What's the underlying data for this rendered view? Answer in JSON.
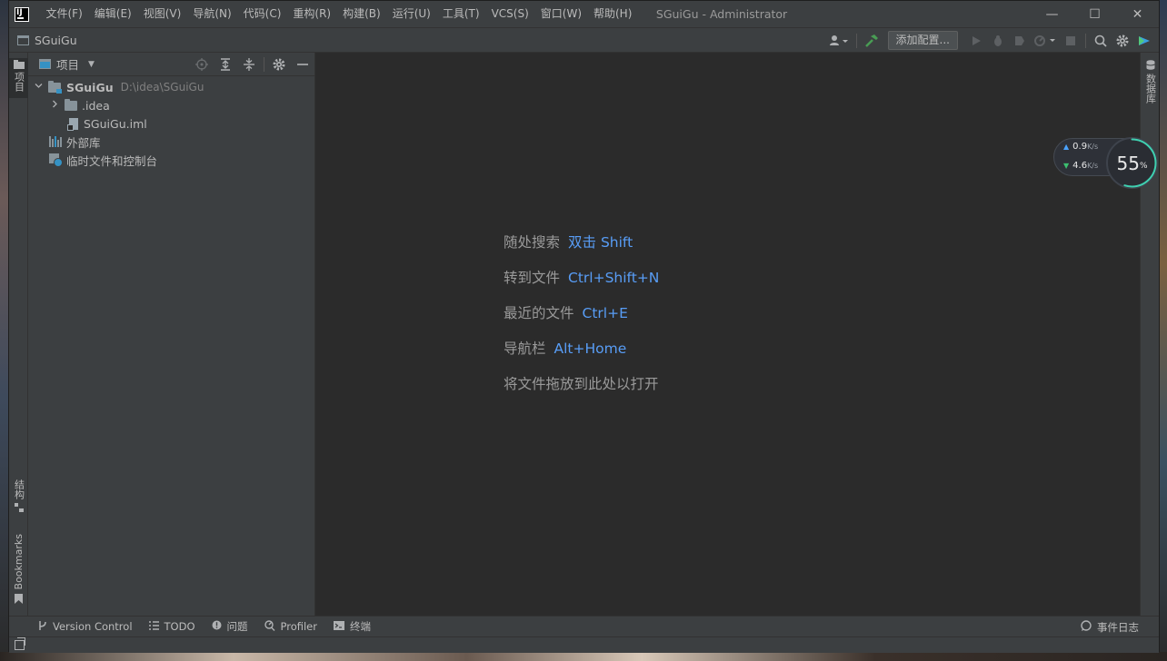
{
  "app": {
    "logo_text": "IJ",
    "window_title": "SGuiGu - Administrator"
  },
  "menu": [
    {
      "label": "文件(F)"
    },
    {
      "label": "编辑(E)"
    },
    {
      "label": "视图(V)"
    },
    {
      "label": "导航(N)"
    },
    {
      "label": "代码(C)"
    },
    {
      "label": "重构(R)"
    },
    {
      "label": "构建(B)"
    },
    {
      "label": "运行(U)"
    },
    {
      "label": "工具(T)"
    },
    {
      "label": "VCS(S)"
    },
    {
      "label": "窗口(W)"
    },
    {
      "label": "帮助(H)"
    }
  ],
  "window_controls": {
    "minimize": "—",
    "maximize": "☐",
    "close": "✕"
  },
  "navbar": {
    "project_name": "SGuiGu",
    "add_config_label": "添加配置...",
    "icons": [
      "user-icon",
      "build-hammer-icon",
      "run-icon",
      "debug-icon",
      "coverage-icon",
      "profile-icon",
      "stop-icon",
      "search-icon",
      "settings-icon",
      "toolbox-icon"
    ]
  },
  "left_stripe": {
    "project_tab": "项目",
    "structure_tab": "结构",
    "bookmarks_tab": "Bookmarks"
  },
  "right_stripe": {
    "database_tab": "数据库"
  },
  "project_panel": {
    "title": "项目",
    "tree": [
      {
        "label": "SGuiGu",
        "hint": "D:\\idea\\SGuiGu"
      },
      {
        "label": ".idea"
      },
      {
        "label": "SGuiGu.iml"
      },
      {
        "label": "外部库"
      },
      {
        "label": "临时文件和控制台"
      }
    ]
  },
  "editor_hints": [
    {
      "label": "随处搜索",
      "key": "双击 Shift"
    },
    {
      "label": "转到文件",
      "key": "Ctrl+Shift+N"
    },
    {
      "label": "最近的文件",
      "key": "Ctrl+E"
    },
    {
      "label": "导航栏",
      "key": "Alt+Home"
    },
    {
      "label": "将文件拖放到此处以打开",
      "key": ""
    }
  ],
  "net_widget": {
    "upload": "0.9",
    "download": "4.6",
    "unit": "K/s",
    "percent": "55",
    "percent_sign": "%",
    "percent_value": 55
  },
  "bottom_tools": [
    {
      "label": "Version Control",
      "icon": "branch-icon"
    },
    {
      "label": "TODO",
      "icon": "list-icon"
    },
    {
      "label": "问题",
      "icon": "problems-icon"
    },
    {
      "label": "Profiler",
      "icon": "profiler-icon"
    },
    {
      "label": "终端",
      "icon": "terminal-icon"
    }
  ],
  "event_log": "事件日志"
}
